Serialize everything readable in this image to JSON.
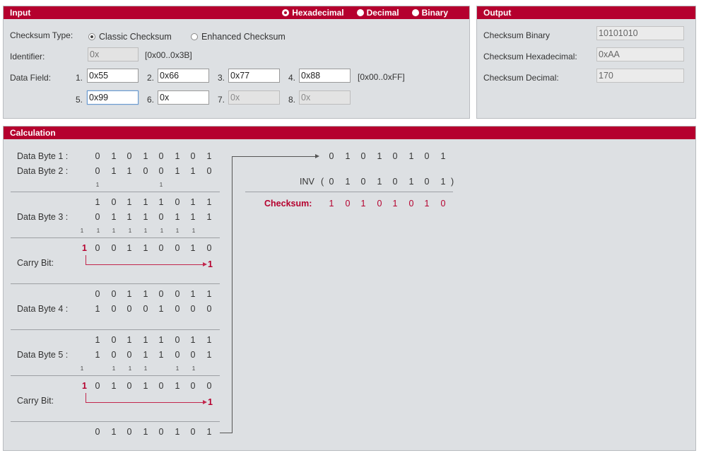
{
  "input": {
    "title": "Input",
    "formats": [
      {
        "label": "Hexadecimal",
        "selected": true
      },
      {
        "label": "Decimal",
        "selected": false
      },
      {
        "label": "Binary",
        "selected": false
      }
    ],
    "checksum_type_label": "Checksum Type:",
    "checksum_types": [
      {
        "label": "Classic Checksum",
        "selected": true
      },
      {
        "label": "Enhanced Checksum",
        "selected": false
      }
    ],
    "identifier_label": "Identifier:",
    "identifier_placeholder": "0x",
    "identifier_range": "[0x00..0x3B]",
    "data_field_label": "Data Field:",
    "data_range": "[0x00..0xFF]",
    "fields": [
      {
        "num": "1.",
        "value": "0x55",
        "enabled": true
      },
      {
        "num": "2.",
        "value": "0x66",
        "enabled": true
      },
      {
        "num": "3.",
        "value": "0x77",
        "enabled": true
      },
      {
        "num": "4.",
        "value": "0x88",
        "enabled": true
      },
      {
        "num": "5.",
        "value": "0x99",
        "enabled": true
      },
      {
        "num": "6.",
        "value": "0x",
        "enabled": true
      },
      {
        "num": "7.",
        "value": "0x",
        "enabled": false
      },
      {
        "num": "8.",
        "value": "0x",
        "enabled": false
      }
    ]
  },
  "output": {
    "title": "Output",
    "binary_label": "Checksum Binary",
    "binary_value": "10101010",
    "hex_label": "Checksum Hexadecimal:",
    "hex_value": "0xAA",
    "dec_label": "Checksum Decimal:",
    "dec_value": "170"
  },
  "calculation": {
    "title": "Calculation",
    "data_byte_1_label": "Data Byte 1 :",
    "data_byte_2_label": "Data Byte 2 :",
    "data_byte_3_label": "Data Byte 3 :",
    "data_byte_4_label": "Data Byte 4 :",
    "data_byte_5_label": "Data Byte 5 :",
    "carry_bit_label": "Carry Bit:",
    "carry_one": "1",
    "inv_label": "INV",
    "open_paren": "(",
    "close_paren": ")",
    "checksum_label": "Checksum:",
    "rows": {
      "b1": [
        "0",
        "1",
        "0",
        "1",
        "0",
        "1",
        "0",
        "1"
      ],
      "b2": [
        "0",
        "1",
        "1",
        "0",
        "0",
        "1",
        "1",
        "0"
      ],
      "c2": [
        "1",
        "",
        "",
        "",
        "1",
        "",
        "",
        ""
      ],
      "s1": [
        "1",
        "0",
        "1",
        "1",
        "1",
        "0",
        "1",
        "1"
      ],
      "b3": [
        "0",
        "1",
        "1",
        "1",
        "0",
        "1",
        "1",
        "1"
      ],
      "c3": [
        "1",
        "1",
        "1",
        "1",
        "1",
        "1",
        "1",
        "1"
      ],
      "s2": [
        "0",
        "0",
        "1",
        "1",
        "0",
        "0",
        "1",
        "0"
      ],
      "s2_overflow": "1",
      "s3": [
        "0",
        "0",
        "1",
        "1",
        "0",
        "0",
        "1",
        "1"
      ],
      "b4": [
        "1",
        "0",
        "0",
        "0",
        "1",
        "0",
        "0",
        "0"
      ],
      "s4": [
        "1",
        "0",
        "1",
        "1",
        "1",
        "0",
        "1",
        "1"
      ],
      "b5": [
        "1",
        "0",
        "0",
        "1",
        "1",
        "0",
        "0",
        "1"
      ],
      "c5": [
        "1",
        "",
        "1",
        "1",
        "1",
        "",
        "1",
        "1"
      ],
      "s5": [
        "0",
        "1",
        "0",
        "1",
        "0",
        "1",
        "0",
        "0"
      ],
      "s5_overflow": "1",
      "final": [
        "0",
        "1",
        "0",
        "1",
        "0",
        "1",
        "0",
        "1"
      ],
      "result": [
        "0",
        "1",
        "0",
        "1",
        "0",
        "1",
        "0",
        "1"
      ],
      "inv": [
        "0",
        "1",
        "0",
        "1",
        "0",
        "1",
        "0",
        "1"
      ],
      "checksum": [
        "1",
        "0",
        "1",
        "0",
        "1",
        "0",
        "1",
        "0"
      ]
    }
  }
}
